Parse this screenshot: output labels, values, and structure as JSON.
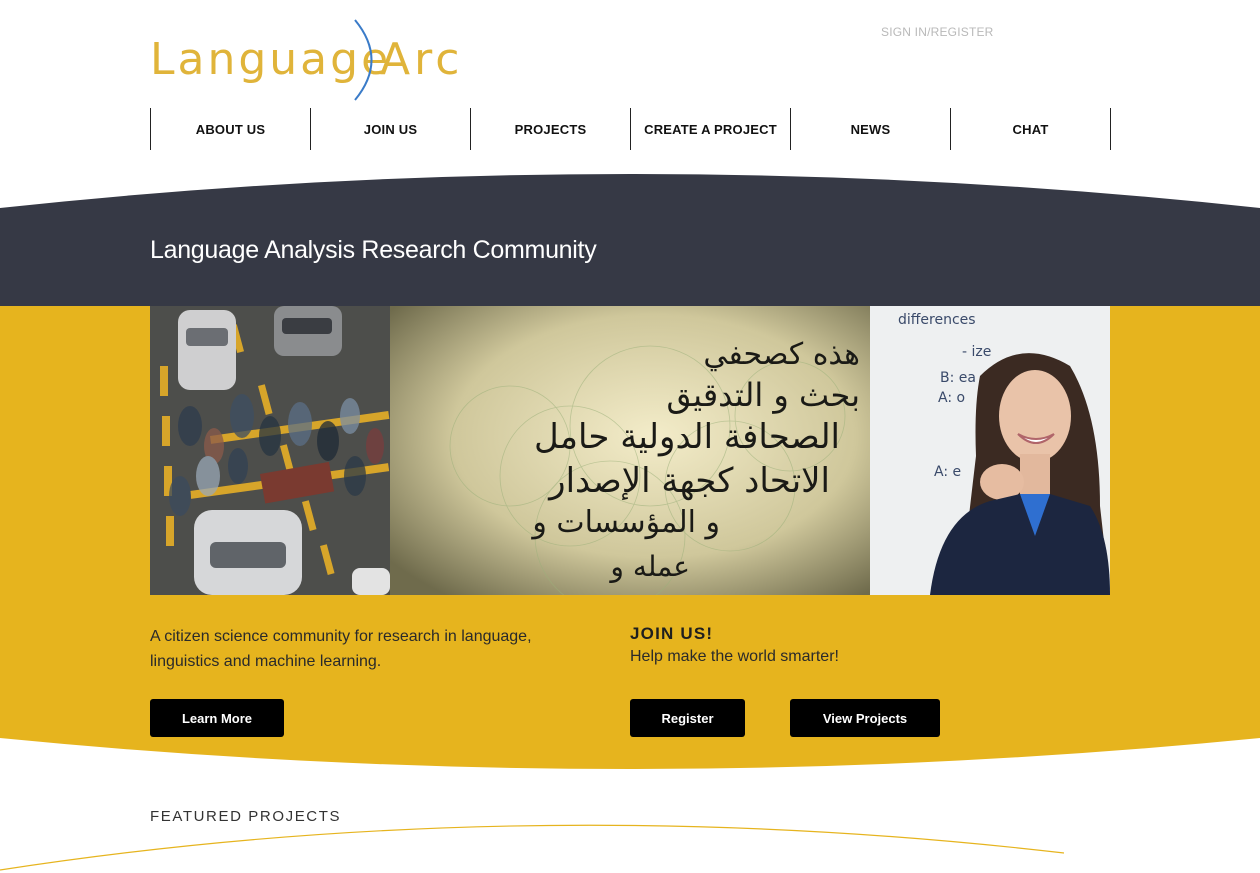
{
  "header": {
    "logo_text_1": "Language",
    "logo_text_2": "Arc",
    "signin_label": "SIGN IN/REGISTER"
  },
  "nav": {
    "items": [
      "ABOUT US",
      "JOIN US",
      "PROJECTS",
      "CREATE A PROJECT",
      "NEWS",
      "CHAT"
    ]
  },
  "hero": {
    "title": "Language Analysis Research Community",
    "arabic_lines": [
      "هذه كصحفي",
      "بحث و التدقيق",
      "الصحافة الدولية حامل",
      "الاتحاد كجهة الإصدار",
      "و المؤسسات و",
      "عمله و"
    ],
    "whiteboard_lines": [
      "differences",
      "- ize",
      "B: ea",
      "A: o",
      "A: e"
    ]
  },
  "info": {
    "tagline": "A citizen science community for research in language, linguistics and machine learning.",
    "join_title": "JOIN US!",
    "join_subtitle": "Help make the world smarter!",
    "learn_more_label": "Learn More",
    "register_label": "Register",
    "view_projects_label": "View Projects"
  },
  "featured": {
    "heading": "FEATURED PROJECTS"
  },
  "colors": {
    "brand_yellow": "#e6b41e",
    "logo_yellow": "#e0b43a",
    "arc_blue": "#3a7bc8",
    "dark_band": "#363945",
    "button_black": "#000000"
  }
}
